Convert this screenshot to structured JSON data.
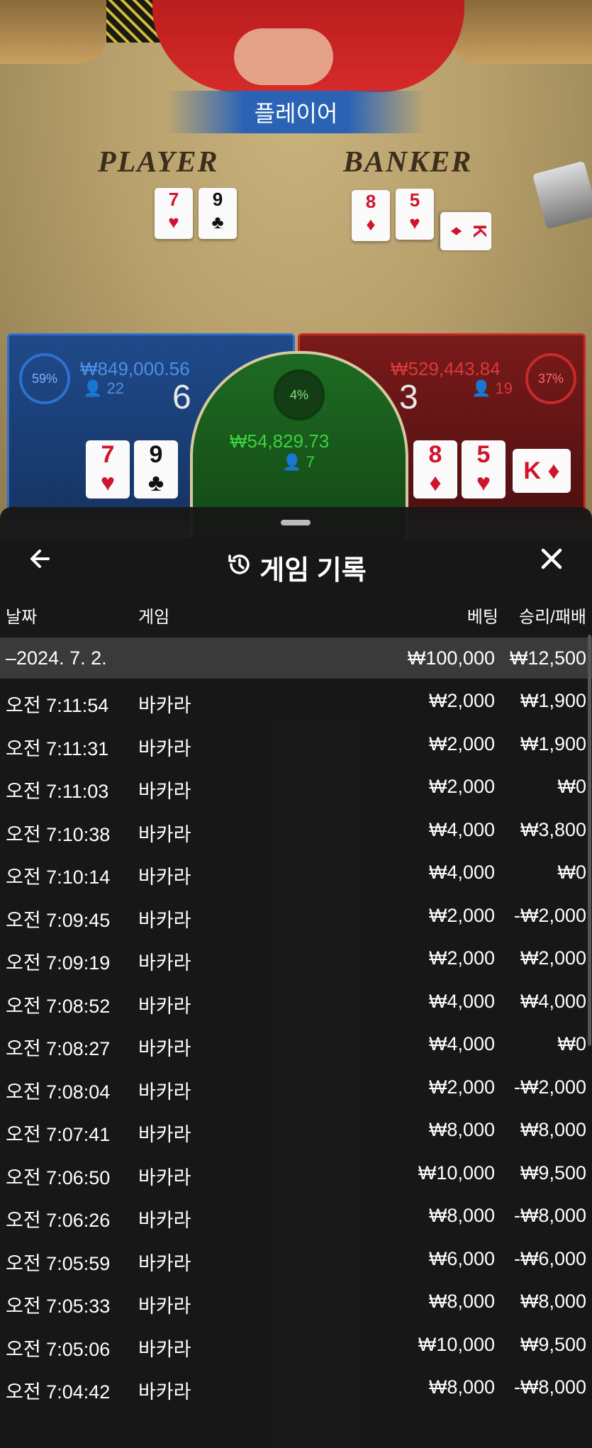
{
  "table": {
    "banner": "플레이어",
    "player_label": "PLAYER",
    "banker_label": "BANKER",
    "player_cards": [
      {
        "rank": "7",
        "suit": "♥",
        "color": "red"
      },
      {
        "rank": "9",
        "suit": "♣",
        "color": "black"
      }
    ],
    "banker_cards": [
      {
        "rank": "8",
        "suit": "♦",
        "color": "red"
      },
      {
        "rank": "5",
        "suit": "♥",
        "color": "red"
      },
      {
        "rank": "K",
        "suit": "♦",
        "color": "red"
      }
    ],
    "player_bet": {
      "percent": "59%",
      "amount": "₩849,000.56",
      "count": "22",
      "score": "6"
    },
    "banker_bet": {
      "percent": "37%",
      "amount": "₩529,443.84",
      "count": "19",
      "score": "3"
    },
    "tie_bet": {
      "percent": "4%",
      "amount": "₩54,829.73",
      "count": "7"
    },
    "colors": {
      "player": "#2f6fd0",
      "banker": "#c82a2a",
      "tie": "#1e6b22",
      "table": "#b69f6b"
    }
  },
  "history": {
    "title": "게임 기록",
    "back_icon": "left-arrow",
    "history_icon": "clock-history",
    "close_icon": "x",
    "columns": {
      "date": "날짜",
      "game": "게임",
      "bet": "베팅",
      "result": "승리/패배"
    },
    "date_row": {
      "date": "–2024. 7. 2.",
      "bet": "₩100,000",
      "result": "₩12,500"
    },
    "rows": [
      {
        "time": "오전 7:11:54",
        "game": "바카라",
        "bet": "₩2,000",
        "result": "₩1,900"
      },
      {
        "time": "오전 7:11:31",
        "game": "바카라",
        "bet": "₩2,000",
        "result": "₩1,900"
      },
      {
        "time": "오전 7:11:03",
        "game": "바카라",
        "bet": "₩2,000",
        "result": "₩0"
      },
      {
        "time": "오전 7:10:38",
        "game": "바카라",
        "bet": "₩4,000",
        "result": "₩3,800"
      },
      {
        "time": "오전 7:10:14",
        "game": "바카라",
        "bet": "₩4,000",
        "result": "₩0"
      },
      {
        "time": "오전 7:09:45",
        "game": "바카라",
        "bet": "₩2,000",
        "result": "-₩2,000"
      },
      {
        "time": "오전 7:09:19",
        "game": "바카라",
        "bet": "₩2,000",
        "result": "₩2,000"
      },
      {
        "time": "오전 7:08:52",
        "game": "바카라",
        "bet": "₩4,000",
        "result": "₩4,000"
      },
      {
        "time": "오전 7:08:27",
        "game": "바카라",
        "bet": "₩4,000",
        "result": "₩0"
      },
      {
        "time": "오전 7:08:04",
        "game": "바카라",
        "bet": "₩2,000",
        "result": "-₩2,000"
      },
      {
        "time": "오전 7:07:41",
        "game": "바카라",
        "bet": "₩8,000",
        "result": "₩8,000"
      },
      {
        "time": "오전 7:06:50",
        "game": "바카라",
        "bet": "₩10,000",
        "result": "₩9,500"
      },
      {
        "time": "오전 7:06:26",
        "game": "바카라",
        "bet": "₩8,000",
        "result": "-₩8,000"
      },
      {
        "time": "오전 7:05:59",
        "game": "바카라",
        "bet": "₩6,000",
        "result": "-₩6,000"
      },
      {
        "time": "오전 7:05:33",
        "game": "바카라",
        "bet": "₩8,000",
        "result": "₩8,000"
      },
      {
        "time": "오전 7:05:06",
        "game": "바카라",
        "bet": "₩10,000",
        "result": "₩9,500"
      },
      {
        "time": "오전 7:04:42",
        "game": "바카라",
        "bet": "₩8,000",
        "result": "-₩8,000"
      }
    ]
  }
}
